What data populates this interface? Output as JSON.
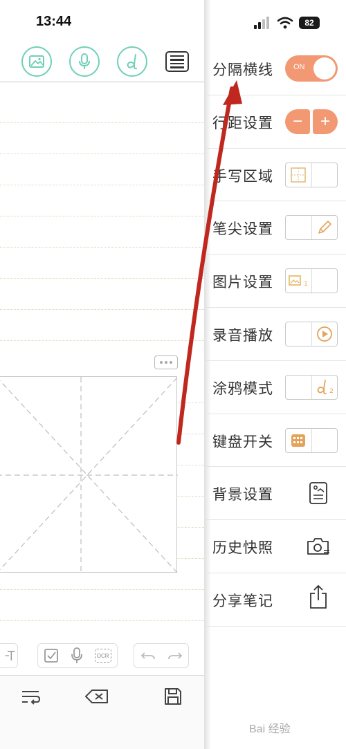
{
  "status": {
    "time": "13:44",
    "battery": "82"
  },
  "settings": [
    {
      "label": "分隔横线",
      "control": "toggle",
      "toggle_text": "ON"
    },
    {
      "label": "行距设置",
      "control": "stepper",
      "minus": "−",
      "plus": "+"
    },
    {
      "label": "手写区域",
      "control": "image-toggle",
      "icon": "grid-icon"
    },
    {
      "label": "笔尖设置",
      "control": "image-toggle",
      "icon": "pencil-icon"
    },
    {
      "label": "图片设置",
      "control": "image-toggle",
      "icon": "image-icon",
      "sub": "1"
    },
    {
      "label": "录音播放",
      "control": "image-toggle",
      "icon": "play-icon"
    },
    {
      "label": "涂鸦模式",
      "control": "image-toggle",
      "icon": "doodle-icon",
      "sub": "2"
    },
    {
      "label": "键盘开关",
      "control": "image-toggle",
      "icon": "keyboard-icon"
    },
    {
      "label": "背景设置",
      "control": "icon",
      "icon": "background-icon"
    },
    {
      "label": "历史快照",
      "control": "icon",
      "icon": "camera-icon"
    },
    {
      "label": "分享笔记",
      "control": "icon",
      "icon": "share-icon"
    }
  ],
  "toolbar": {
    "ocr_label": "OCR"
  },
  "colors": {
    "accent": "#f29872",
    "teal": "#6fcfb8",
    "arrow": "#c0281f",
    "dash": "#e6dcc6"
  },
  "watermark": "Bai 经验"
}
